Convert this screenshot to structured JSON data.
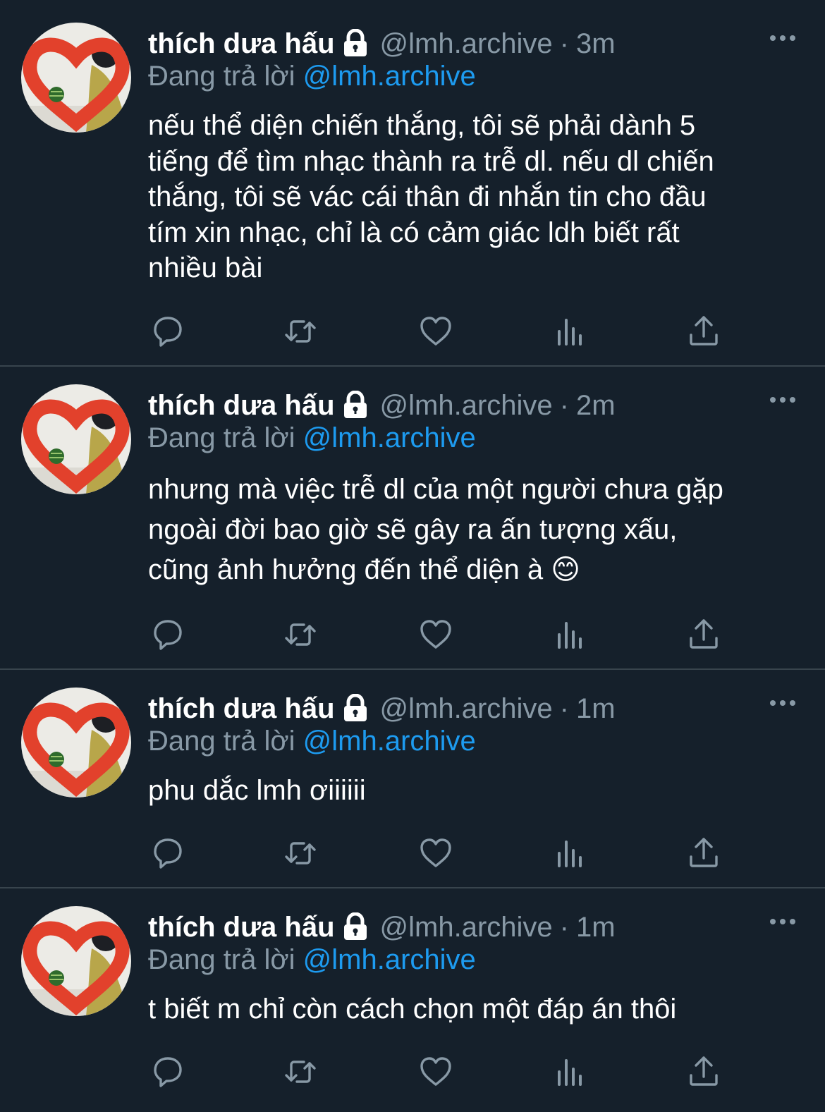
{
  "tweets": [
    {
      "name": "thích dưa hấu",
      "handle": "@lmh.archive",
      "dot": "·",
      "time": "3m",
      "reply_prefix": "Đang trả lời ",
      "reply_to": "@lmh.archive",
      "text": "nếu thể diện chiến thắng, tôi sẽ phải dành 5\ntiếng để tìm nhạc thành ra trễ dl. nếu dl chiến\nthắng, tôi sẽ vác cái thân đi nhắn tin cho đầu\ntím xin nhạc, chỉ là có cảm giác ldh biết rất\nnhiều bài"
    },
    {
      "name": "thích dưa hấu",
      "handle": "@lmh.archive",
      "dot": "·",
      "time": "2m",
      "reply_prefix": "Đang trả lời ",
      "reply_to": "@lmh.archive",
      "text": "nhưng mà việc trễ dl của một người chưa gặp\nngoài đời bao giờ sẽ gây ra ấn tượng xấu,\ncũng ảnh hưởng đến thể diện à 😊"
    },
    {
      "name": "thích dưa hấu",
      "handle": "@lmh.archive",
      "dot": "·",
      "time": "1m",
      "reply_prefix": "Đang trả lời ",
      "reply_to": "@lmh.archive",
      "text": "phu dắc lmh ơiiiiii"
    },
    {
      "name": "thích dưa hấu",
      "handle": "@lmh.archive",
      "dot": "·",
      "time": "1m",
      "reply_prefix": "Đang trả lời ",
      "reply_to": "@lmh.archive",
      "text": "t biết m chỉ còn cách chọn một đáp án thôi"
    }
  ],
  "icons": {
    "reply": "reply-icon",
    "retweet": "retweet-icon",
    "like": "heart-icon",
    "views": "views-icon",
    "share": "share-icon",
    "lock": "lock-icon",
    "more": "more-icon"
  },
  "colors": {
    "background": "#15202b",
    "secondary_text": "#8899a6",
    "link": "#1d9bf0",
    "divider": "#38444d"
  }
}
